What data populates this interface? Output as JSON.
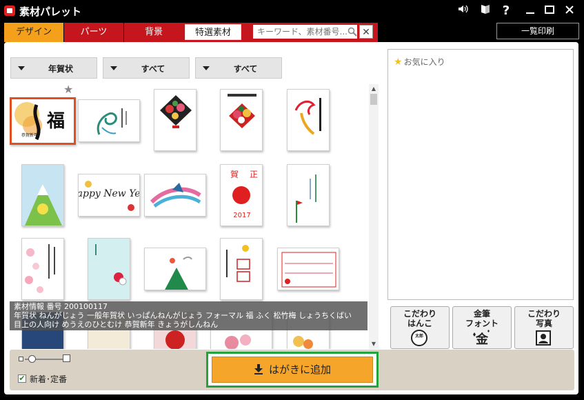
{
  "app": {
    "title": "素材パレット"
  },
  "tabs": [
    {
      "label": "デザイン"
    },
    {
      "label": "パーツ"
    },
    {
      "label": "背景"
    },
    {
      "label": "特選素材"
    }
  ],
  "search": {
    "placeholder": "キーワード、素材番号..."
  },
  "toolbar": {
    "print_all_label": "一覧印刷"
  },
  "filters": [
    {
      "label": "年賀状"
    },
    {
      "label": "すべて"
    },
    {
      "label": "すべて"
    }
  ],
  "info": {
    "line1": "素材情報 番号 200100117",
    "line2": "年賀状 ねんがじょう 一般年賀状 いっぱんねんがじょう フォーマル 福 ふく 松竹梅 しょうちくばい",
    "line3": "目上の人向け めうえのひとむけ 恭賀新年 きょうがしんねん"
  },
  "favorites": {
    "title": "お気に入り"
  },
  "side_buttons": [
    {
      "line1": "こだわり",
      "line2": "はんこ",
      "icon": "stamp-icon",
      "glyph": "太郎"
    },
    {
      "line1": "金筆",
      "line2": "フォント",
      "icon": "gold-font-icon",
      "glyph": "金"
    },
    {
      "line1": "こだわり",
      "line2": "写真",
      "icon": "photo-icon",
      "glyph": ""
    }
  ],
  "bottom": {
    "checkbox_label": "新着･定番",
    "checkbox_checked": true,
    "add_button_label": "はがきに追加"
  },
  "thumbnail_texts": {
    "hny": "Happy New Year",
    "year": "2017",
    "kanji_ga": "賀",
    "kanji_sho": "正",
    "kanji_fuku": "福",
    "kanji_kingashinen": "恭賀新年"
  },
  "colors": {
    "accent_red": "#c4161c",
    "active_tab": "#f5a01a",
    "add_button": "#f5a62a",
    "highlight_green": "#22a33b",
    "selected_border": "#e0501e"
  }
}
